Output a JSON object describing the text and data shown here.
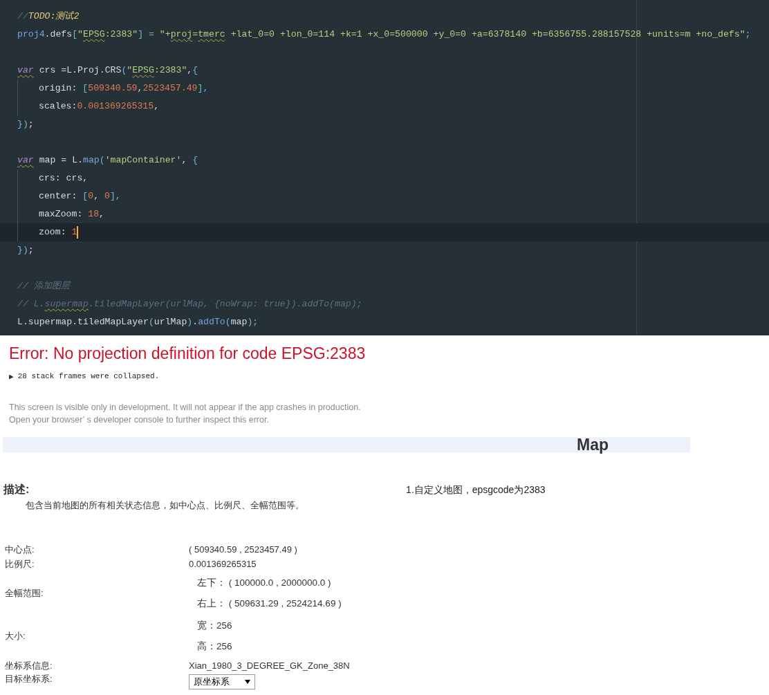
{
  "code_editor": {
    "lines": [
      {
        "kind": "code",
        "indented": false,
        "current": false,
        "tokens": [
          {
            "text": "//",
            "kind": "comment",
            "squiggle": false
          },
          {
            "text": "TODO:测试2",
            "kind": "todo",
            "squiggle": false
          }
        ]
      },
      {
        "kind": "code",
        "indented": false,
        "current": false,
        "tokens": [
          {
            "text": "proj4",
            "kind": "func",
            "squiggle": false
          },
          {
            "text": ".defs",
            "kind": "plain",
            "squiggle": false
          },
          {
            "text": "[",
            "kind": "punct",
            "squiggle": false
          },
          {
            "text": "\"",
            "kind": "string",
            "squiggle": false
          },
          {
            "text": "EPSG",
            "kind": "string",
            "squiggle": true
          },
          {
            "text": ":2383\"",
            "kind": "string",
            "squiggle": false
          },
          {
            "text": "] = ",
            "kind": "punct",
            "squiggle": false
          },
          {
            "text": "\"+",
            "kind": "string",
            "squiggle": false
          },
          {
            "text": "proj",
            "kind": "string",
            "squiggle": true
          },
          {
            "text": "=",
            "kind": "string",
            "squiggle": false
          },
          {
            "text": "tmerc",
            "kind": "string",
            "squiggle": true
          },
          {
            "text": " +lat_0=0 +lon_0=114 +k=1 +x_0=500000 +y_0=0 +a=6378140 +b=6356755.288157528 +units=m +no_defs\"",
            "kind": "string",
            "squiggle": false
          },
          {
            "text": ";",
            "kind": "punct",
            "squiggle": false
          }
        ]
      },
      {
        "kind": "blank"
      },
      {
        "kind": "code",
        "indented": false,
        "current": false,
        "tokens": [
          {
            "text": "var",
            "kind": "keyword",
            "squiggle": true
          },
          {
            "text": " crs =L.Proj.CRS",
            "kind": "plain",
            "squiggle": false
          },
          {
            "text": "(",
            "kind": "punct",
            "squiggle": false
          },
          {
            "text": "\"",
            "kind": "string",
            "squiggle": false
          },
          {
            "text": "EPSG",
            "kind": "string",
            "squiggle": true
          },
          {
            "text": ":2383\"",
            "kind": "string",
            "squiggle": false
          },
          {
            "text": ",",
            "kind": "plain",
            "squiggle": false
          },
          {
            "text": "{",
            "kind": "punct",
            "squiggle": false
          }
        ]
      },
      {
        "kind": "code",
        "indented": true,
        "current": false,
        "tokens": [
          {
            "text": "origin: ",
            "kind": "plain",
            "squiggle": false
          },
          {
            "text": "[",
            "kind": "punct",
            "squiggle": false
          },
          {
            "text": "509340.59",
            "kind": "number",
            "squiggle": false
          },
          {
            "text": ",",
            "kind": "plain",
            "squiggle": false
          },
          {
            "text": "2523457.49",
            "kind": "number",
            "squiggle": false
          },
          {
            "text": "],",
            "kind": "punct",
            "squiggle": false
          }
        ]
      },
      {
        "kind": "code",
        "indented": true,
        "current": false,
        "tokens": [
          {
            "text": "scales:",
            "kind": "plain",
            "squiggle": false
          },
          {
            "text": "0.001369265315",
            "kind": "number",
            "squiggle": false
          },
          {
            "text": ",",
            "kind": "plain",
            "squiggle": false
          }
        ]
      },
      {
        "kind": "code",
        "indented": false,
        "current": false,
        "tokens": [
          {
            "text": "})",
            "kind": "punct",
            "squiggle": false
          },
          {
            "text": ";",
            "kind": "plain",
            "squiggle": false
          }
        ]
      },
      {
        "kind": "blank"
      },
      {
        "kind": "code",
        "indented": false,
        "current": false,
        "tokens": [
          {
            "text": "var",
            "kind": "keyword",
            "squiggle": true
          },
          {
            "text": " map = L.",
            "kind": "plain",
            "squiggle": false
          },
          {
            "text": "map",
            "kind": "func",
            "squiggle": false
          },
          {
            "text": "(",
            "kind": "punct",
            "squiggle": false
          },
          {
            "text": "'mapContainer'",
            "kind": "string",
            "squiggle": false
          },
          {
            "text": ", ",
            "kind": "plain",
            "squiggle": false
          },
          {
            "text": "{",
            "kind": "punct",
            "squiggle": false
          }
        ]
      },
      {
        "kind": "code",
        "indented": true,
        "current": false,
        "tokens": [
          {
            "text": "crs: crs,",
            "kind": "plain",
            "squiggle": false
          }
        ]
      },
      {
        "kind": "code",
        "indented": true,
        "current": false,
        "tokens": [
          {
            "text": "center: ",
            "kind": "plain",
            "squiggle": false
          },
          {
            "text": "[",
            "kind": "punct",
            "squiggle": false
          },
          {
            "text": "0",
            "kind": "number",
            "squiggle": false
          },
          {
            "text": ", ",
            "kind": "plain",
            "squiggle": false
          },
          {
            "text": "0",
            "kind": "number",
            "squiggle": false
          },
          {
            "text": "],",
            "kind": "punct",
            "squiggle": false
          }
        ]
      },
      {
        "kind": "code",
        "indented": true,
        "current": false,
        "tokens": [
          {
            "text": "maxZoom: ",
            "kind": "plain",
            "squiggle": false
          },
          {
            "text": "18",
            "kind": "number",
            "squiggle": false
          },
          {
            "text": ",",
            "kind": "plain",
            "squiggle": false
          }
        ]
      },
      {
        "kind": "code",
        "indented": true,
        "current": true,
        "tokens": [
          {
            "text": "zoom: ",
            "kind": "plain",
            "squiggle": false
          },
          {
            "text": "1",
            "kind": "number",
            "squiggle": false
          }
        ]
      },
      {
        "kind": "code",
        "indented": false,
        "current": false,
        "tokens": [
          {
            "text": "})",
            "kind": "punct",
            "squiggle": false
          },
          {
            "text": ";",
            "kind": "plain",
            "squiggle": false
          }
        ]
      },
      {
        "kind": "blank"
      },
      {
        "kind": "code",
        "indented": false,
        "current": false,
        "tokens": [
          {
            "text": "// 添加图层",
            "kind": "comment",
            "squiggle": false
          }
        ]
      },
      {
        "kind": "code",
        "indented": false,
        "current": false,
        "tokens": [
          {
            "text": "// L.",
            "kind": "comment",
            "squiggle": false
          },
          {
            "text": "supermap",
            "kind": "comment",
            "squiggle": true
          },
          {
            "text": ".tiledMapLayer(urlMap, {noWrap: true}).addTo(map);",
            "kind": "comment",
            "squiggle": false
          }
        ]
      },
      {
        "kind": "code",
        "indented": false,
        "current": false,
        "tokens": [
          {
            "text": "L.supermap.tiledMapLayer",
            "kind": "plain",
            "squiggle": false
          },
          {
            "text": "(",
            "kind": "punct",
            "squiggle": false
          },
          {
            "text": "urlMap",
            "kind": "plain",
            "squiggle": false
          },
          {
            "text": ")",
            "kind": "punct",
            "squiggle": false
          },
          {
            "text": ".",
            "kind": "plain",
            "squiggle": false
          },
          {
            "text": "addTo",
            "kind": "func",
            "squiggle": false
          },
          {
            "text": "(",
            "kind": "punct",
            "squiggle": false
          },
          {
            "text": "map",
            "kind": "plain",
            "squiggle": false
          },
          {
            "text": ");",
            "kind": "punct",
            "squiggle": false
          }
        ]
      }
    ]
  },
  "error_overlay": {
    "title": "Error: No projection definition for code EPSG:2383",
    "stack_toggle": "▶",
    "stack_summary": "28 stack frames were collapsed.",
    "notes": [
      "This screen is visible only in development. It will not appear if the app crashes in production.",
      "Open your browser’  s developer console to further inspect this error."
    ]
  },
  "map_panel": {
    "title": "Map",
    "description_label": "描述:",
    "description": "包含当前地图的所有相关状态信息，如中心点、比例尺、全幅范围等。",
    "note": "1.自定义地图，epsgcode为2383",
    "rows": [
      {
        "kind": "text",
        "label": "中心点:",
        "value": "( 509340.59 , 2523457.49 )"
      },
      {
        "kind": "text",
        "label": "比例尺:",
        "value": "0.001369265315"
      },
      {
        "kind": "pair",
        "label": "全幅范围:",
        "items": [
          "左下： ( 100000.0 , 2000000.0 )",
          "右上： ( 509631.29 , 2524214.69 )"
        ]
      },
      {
        "kind": "pair",
        "label": "大小:",
        "items": [
          "宽：256",
          "高：256"
        ]
      },
      {
        "kind": "text",
        "label": "坐标系信息:",
        "value": "Xian_1980_3_DEGREE_GK_Zone_38N"
      },
      {
        "kind": "select",
        "label": "目标坐标系:",
        "value": "原坐标系"
      }
    ]
  }
}
